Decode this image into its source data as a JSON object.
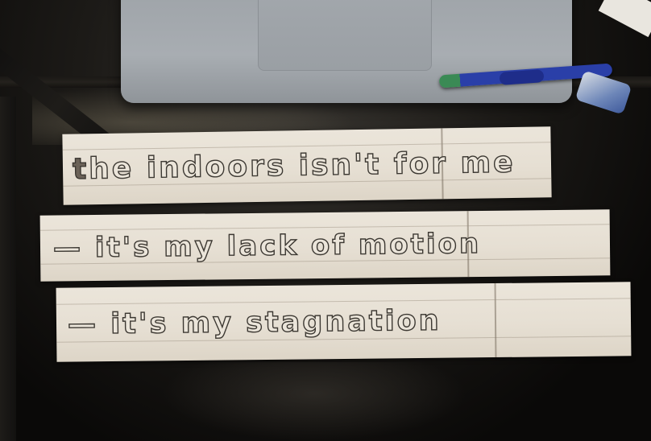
{
  "photo": {
    "objects": {
      "laptop": "laptop",
      "pen": "pen",
      "eraser": "eraser"
    },
    "strips": [
      {
        "text_first": "t",
        "text_rest": "he indoors isn't for me"
      },
      {
        "text": "— it's my lack of motion"
      },
      {
        "text": "— it's my stagnation"
      }
    ]
  }
}
